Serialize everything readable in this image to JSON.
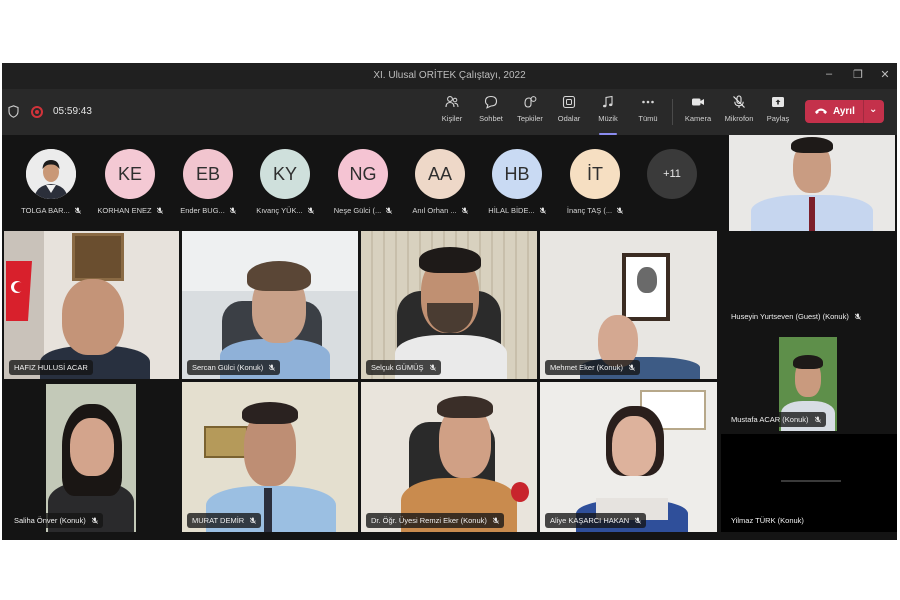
{
  "window": {
    "title": "XI. Ulusal ORİTEK Çalıştayı, 2022",
    "controls": {
      "minimize": "–",
      "maximize": "❐",
      "close": "✕"
    }
  },
  "toolbar": {
    "timer": "05:59:43",
    "buttons": [
      {
        "name": "people",
        "label": "Kişiler",
        "icon": "people-icon"
      },
      {
        "name": "chat",
        "label": "Sohbet",
        "icon": "chat-icon"
      },
      {
        "name": "reactions",
        "label": "Tepkiler",
        "icon": "reactions-icon"
      },
      {
        "name": "rooms",
        "label": "Odalar",
        "icon": "rooms-icon"
      },
      {
        "name": "music",
        "label": "Müzik",
        "icon": "music-icon",
        "active": true
      },
      {
        "name": "more",
        "label": "Tümü",
        "icon": "more-icon"
      },
      {
        "name": "camera",
        "label": "Kamera",
        "icon": "camera-icon"
      },
      {
        "name": "mic",
        "label": "Mikrofon",
        "icon": "mic-off-icon"
      },
      {
        "name": "share",
        "label": "Paylaş",
        "icon": "share-icon"
      }
    ],
    "leave_label": "Ayrıl",
    "leave_color": "#c4314b",
    "accent": "#8b8cf0"
  },
  "avatar_strip": [
    {
      "initials": "",
      "name": "TOLGA BAR...",
      "photo": true
    },
    {
      "initials": "KE",
      "name": "KORHAN ENEZ",
      "color": "#f4c9d4"
    },
    {
      "initials": "EB",
      "name": "Ender BUG...",
      "color": "#f1c5cf"
    },
    {
      "initials": "KY",
      "name": "Kıvanç YÜK...",
      "color": "#cfe0dc"
    },
    {
      "initials": "NG",
      "name": "Neşe Gülci (...",
      "color": "#f5c4d3"
    },
    {
      "initials": "AA",
      "name": "Anıl Orhan ...",
      "color": "#eed8c8"
    },
    {
      "initials": "HB",
      "name": "HİLAL BİDE...",
      "color": "#c9daf3"
    },
    {
      "initials": "İT",
      "name": "İnanç TAŞ (...",
      "color": "#f6dfc2"
    }
  ],
  "overflow_count": "+11",
  "video_tiles": [
    {
      "name": "HAFIZ HULUSİ ACAR"
    },
    {
      "name": "Sercan Gülci (Konuk)"
    },
    {
      "name": "Selçuk GÜMÜŞ"
    },
    {
      "name": "Mehmet Eker (Konuk)"
    },
    {
      "name": "Saliha Önver (Konuk)"
    },
    {
      "name": "MURAT DEMİR"
    },
    {
      "name": "Dr. Öğr. Üyesi Remzi Eker (Konuk)"
    },
    {
      "name": "Aliye KAŞARCI HAKAN"
    }
  ],
  "side_tiles": [
    {
      "name": "Huseyin Yurtseven (Guest) (Konuk)"
    },
    {
      "name": "Mustafa ACAR (Konuk)"
    },
    {
      "name": "Yilmaz TÜRK (Konuk)"
    }
  ]
}
